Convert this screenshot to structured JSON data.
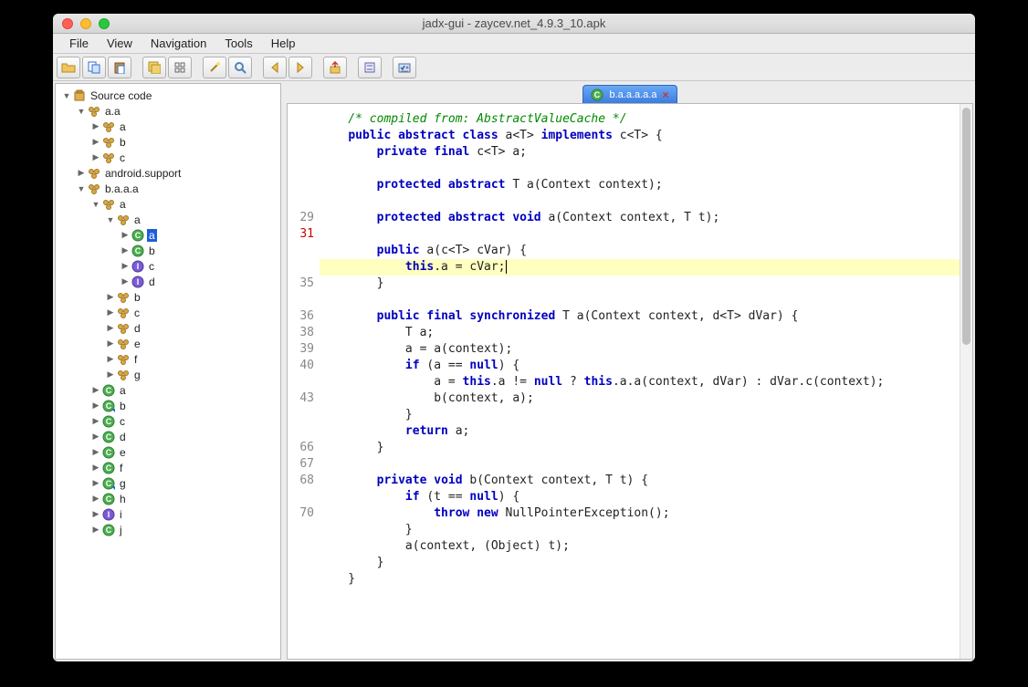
{
  "window": {
    "title": "jadx-gui - zaycev.net_4.9.3_10.apk"
  },
  "menu": {
    "items": [
      "File",
      "View",
      "Navigation",
      "Tools",
      "Help"
    ]
  },
  "toolbar": {
    "buttons": [
      "open",
      "copy",
      "paste",
      "save-all",
      "sync",
      "wand",
      "search",
      "back",
      "forward",
      "export",
      "settings",
      "preferences"
    ]
  },
  "tree": {
    "root": {
      "label": "Source code",
      "icon": "jar"
    },
    "nodes": [
      {
        "depth": 1,
        "tw": "down",
        "icon": "pkg",
        "label": "a.a"
      },
      {
        "depth": 2,
        "tw": "right",
        "icon": "pkg",
        "label": "a"
      },
      {
        "depth": 2,
        "tw": "right",
        "icon": "pkg",
        "label": "b"
      },
      {
        "depth": 2,
        "tw": "right",
        "icon": "pkg",
        "label": "c"
      },
      {
        "depth": 1,
        "tw": "right",
        "icon": "pkg",
        "label": "android.support"
      },
      {
        "depth": 1,
        "tw": "down",
        "icon": "pkg",
        "label": "b.a.a.a"
      },
      {
        "depth": 2,
        "tw": "down",
        "icon": "pkg",
        "label": "a"
      },
      {
        "depth": 3,
        "tw": "down",
        "icon": "pkg",
        "label": "a"
      },
      {
        "depth": 4,
        "tw": "right",
        "icon": "class",
        "label": "a",
        "selected": true
      },
      {
        "depth": 4,
        "tw": "right",
        "icon": "class",
        "label": "b"
      },
      {
        "depth": 4,
        "tw": "right",
        "icon": "iface",
        "label": "c"
      },
      {
        "depth": 4,
        "tw": "right",
        "icon": "iface",
        "label": "d"
      },
      {
        "depth": 3,
        "tw": "right",
        "icon": "pkg",
        "label": "b"
      },
      {
        "depth": 3,
        "tw": "right",
        "icon": "pkg",
        "label": "c"
      },
      {
        "depth": 3,
        "tw": "right",
        "icon": "pkg",
        "label": "d"
      },
      {
        "depth": 3,
        "tw": "right",
        "icon": "pkg",
        "label": "e"
      },
      {
        "depth": 3,
        "tw": "right",
        "icon": "pkg",
        "label": "f"
      },
      {
        "depth": 3,
        "tw": "right",
        "icon": "pkg",
        "label": "g"
      },
      {
        "depth": 2,
        "tw": "right",
        "icon": "class",
        "label": "a"
      },
      {
        "depth": 2,
        "tw": "right",
        "icon": "class-s",
        "label": "b"
      },
      {
        "depth": 2,
        "tw": "right",
        "icon": "class",
        "label": "c"
      },
      {
        "depth": 2,
        "tw": "right",
        "icon": "class",
        "label": "d"
      },
      {
        "depth": 2,
        "tw": "right",
        "icon": "class",
        "label": "e"
      },
      {
        "depth": 2,
        "tw": "right",
        "icon": "class",
        "label": "f"
      },
      {
        "depth": 2,
        "tw": "right",
        "icon": "class-s",
        "label": "g"
      },
      {
        "depth": 2,
        "tw": "right",
        "icon": "class",
        "label": "h"
      },
      {
        "depth": 2,
        "tw": "right",
        "icon": "iface",
        "label": "i"
      },
      {
        "depth": 2,
        "tw": "right",
        "icon": "class",
        "label": "j"
      }
    ]
  },
  "tab": {
    "icon": "class",
    "label": "b.a.a.a.a.a",
    "close": "×"
  },
  "gutter": [
    "",
    "",
    "",
    "",
    "",
    "",
    "29",
    "31",
    "",
    "",
    "35",
    "",
    "36",
    "38",
    "39",
    "40",
    "",
    "43",
    "",
    "",
    "66",
    "67",
    "68",
    "",
    "70",
    "",
    ""
  ],
  "gutter_err_index": 7,
  "code": {
    "lines": [
      {
        "t": "comment",
        "text": "    /* compiled from: AbstractValueCache */"
      },
      {
        "t": "code",
        "segs": [
          [
            "    ",
            ""
          ],
          [
            "public abstract class",
            "kw"
          ],
          [
            " a",
            ""
          ],
          [
            "<",
            ""
          ],
          [
            "T",
            ""
          ],
          [
            ">",
            ""
          ],
          [
            " ",
            ""
          ],
          [
            "implements",
            "kw"
          ],
          [
            " c",
            ""
          ],
          [
            "<",
            ""
          ],
          [
            "T",
            ""
          ],
          [
            ">",
            ""
          ],
          [
            " {",
            ""
          ]
        ]
      },
      {
        "t": "code",
        "segs": [
          [
            "        ",
            ""
          ],
          [
            "private final",
            "kw"
          ],
          [
            " c",
            ""
          ],
          [
            "<",
            ""
          ],
          [
            "T",
            ""
          ],
          [
            ">",
            ""
          ],
          [
            " a;",
            ""
          ]
        ]
      },
      {
        "t": "blank"
      },
      {
        "t": "code",
        "segs": [
          [
            "        ",
            ""
          ],
          [
            "protected abstract",
            "kw"
          ],
          [
            " T a",
            ""
          ],
          [
            "(",
            ""
          ],
          [
            "Context context",
            ""
          ],
          [
            ")",
            ""
          ],
          [
            ";",
            ""
          ]
        ]
      },
      {
        "t": "blank"
      },
      {
        "t": "code",
        "segs": [
          [
            "        ",
            ""
          ],
          [
            "protected abstract void",
            "kw"
          ],
          [
            " a",
            ""
          ],
          [
            "(",
            ""
          ],
          [
            "Context context, T t",
            ""
          ],
          [
            ")",
            ""
          ],
          [
            ";",
            ""
          ]
        ]
      },
      {
        "t": "blank"
      },
      {
        "t": "code",
        "segs": [
          [
            "        ",
            ""
          ],
          [
            "public",
            "kw"
          ],
          [
            " a",
            ""
          ],
          [
            "(",
            ""
          ],
          [
            "c",
            ""
          ],
          [
            "<",
            ""
          ],
          [
            "T",
            ""
          ],
          [
            ">",
            ""
          ],
          [
            " cVar",
            ""
          ],
          [
            ")",
            ""
          ],
          [
            " {",
            ""
          ]
        ]
      },
      {
        "t": "code",
        "hl": true,
        "segs": [
          [
            "            ",
            ""
          ],
          [
            "this",
            "kw"
          ],
          [
            ".a = cVar;",
            ""
          ],
          [
            "|",
            "cursor"
          ]
        ]
      },
      {
        "t": "code",
        "segs": [
          [
            "        }",
            ""
          ]
        ]
      },
      {
        "t": "blank"
      },
      {
        "t": "code",
        "segs": [
          [
            "        ",
            ""
          ],
          [
            "public final synchronized",
            "kw"
          ],
          [
            " T a",
            ""
          ],
          [
            "(",
            ""
          ],
          [
            "Context context, d",
            ""
          ],
          [
            "<",
            ""
          ],
          [
            "T",
            ""
          ],
          [
            ">",
            ""
          ],
          [
            " dVar",
            ""
          ],
          [
            ")",
            ""
          ],
          [
            " {",
            ""
          ]
        ]
      },
      {
        "t": "code",
        "segs": [
          [
            "            T a;",
            ""
          ]
        ]
      },
      {
        "t": "code",
        "segs": [
          [
            "            a = a",
            ""
          ],
          [
            "(",
            ""
          ],
          [
            "context",
            ""
          ],
          [
            ")",
            ""
          ],
          [
            ";",
            ""
          ]
        ]
      },
      {
        "t": "code",
        "segs": [
          [
            "            ",
            ""
          ],
          [
            "if",
            "kw"
          ],
          [
            " ",
            ""
          ],
          [
            "(",
            ""
          ],
          [
            "a == ",
            ""
          ],
          [
            "null",
            "kw"
          ],
          [
            ")",
            ""
          ],
          [
            " {",
            ""
          ]
        ]
      },
      {
        "t": "code",
        "segs": [
          [
            "                a = ",
            ""
          ],
          [
            "this",
            "kw"
          ],
          [
            ".a != ",
            ""
          ],
          [
            "null",
            "kw"
          ],
          [
            " ? ",
            ""
          ],
          [
            "this",
            "kw"
          ],
          [
            ".a.a",
            ""
          ],
          [
            "(",
            ""
          ],
          [
            "context, dVar",
            ""
          ],
          [
            ")",
            ""
          ],
          [
            " : dVar.c",
            ""
          ],
          [
            "(",
            ""
          ],
          [
            "context",
            ""
          ],
          [
            ")",
            ""
          ],
          [
            ";",
            ""
          ]
        ]
      },
      {
        "t": "code",
        "segs": [
          [
            "                b",
            ""
          ],
          [
            "(",
            ""
          ],
          [
            "context, a",
            ""
          ],
          [
            ")",
            ""
          ],
          [
            ";",
            ""
          ]
        ]
      },
      {
        "t": "code",
        "segs": [
          [
            "            }",
            ""
          ]
        ]
      },
      {
        "t": "code",
        "segs": [
          [
            "            ",
            ""
          ],
          [
            "return",
            "kw"
          ],
          [
            " a;",
            ""
          ]
        ]
      },
      {
        "t": "code",
        "segs": [
          [
            "        }",
            ""
          ]
        ]
      },
      {
        "t": "blank"
      },
      {
        "t": "code",
        "segs": [
          [
            "        ",
            ""
          ],
          [
            "private void",
            "kw"
          ],
          [
            " b",
            ""
          ],
          [
            "(",
            ""
          ],
          [
            "Context context, T t",
            ""
          ],
          [
            ")",
            ""
          ],
          [
            " {",
            ""
          ]
        ]
      },
      {
        "t": "code",
        "segs": [
          [
            "            ",
            ""
          ],
          [
            "if",
            "kw"
          ],
          [
            " ",
            ""
          ],
          [
            "(",
            ""
          ],
          [
            "t == ",
            ""
          ],
          [
            "null",
            "kw"
          ],
          [
            ")",
            ""
          ],
          [
            " {",
            ""
          ]
        ]
      },
      {
        "t": "code",
        "segs": [
          [
            "                ",
            ""
          ],
          [
            "throw new",
            "kw"
          ],
          [
            " NullPointerException",
            ""
          ],
          [
            "()",
            ""
          ],
          [
            ";",
            ""
          ]
        ]
      },
      {
        "t": "code",
        "segs": [
          [
            "            }",
            ""
          ]
        ]
      },
      {
        "t": "code",
        "segs": [
          [
            "            a",
            ""
          ],
          [
            "(",
            ""
          ],
          [
            "context, ",
            ""
          ],
          [
            "(",
            ""
          ],
          [
            "Object",
            ""
          ],
          [
            ")",
            ""
          ],
          [
            " t",
            ""
          ],
          [
            ")",
            ""
          ],
          [
            ";",
            ""
          ]
        ]
      },
      {
        "t": "code",
        "segs": [
          [
            "        }",
            ""
          ]
        ]
      },
      {
        "t": "code",
        "segs": [
          [
            "    }",
            "trunc"
          ]
        ]
      }
    ]
  }
}
